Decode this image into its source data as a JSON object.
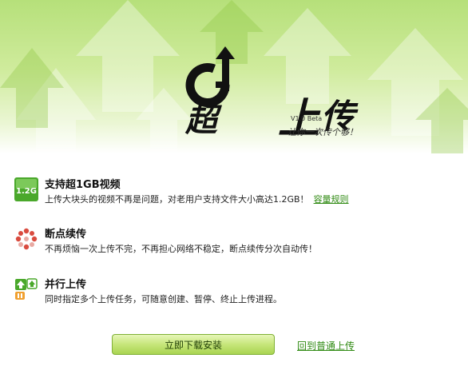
{
  "banner": {
    "logo_chao": "超",
    "logo_shang": "上",
    "logo_chuan": "传",
    "version": "V1.0 Beta",
    "slogan": "让你一次传个够！"
  },
  "features": [
    {
      "icon": "1.2G",
      "title": "支持超1GB视频",
      "desc": "上传大块头的视频不再是问题，对老用户支持文件大小高达1.2GB！",
      "link": "容量规则"
    },
    {
      "icon": "resume-icon",
      "title": "断点续传",
      "desc": "不再烦恼一次上传不完，不再担心网络不稳定，断点续传分次自动传！"
    },
    {
      "icon": "parallel-upload-icon",
      "title": "并行上传",
      "desc": "同时指定多个上传任务，可随意创建、暂停、终止上传进程。"
    }
  ],
  "actions": {
    "install_label": "立即下载安装",
    "back_label": "回到普通上传"
  },
  "colors": {
    "accent": "#2f8a12",
    "banner_green": "#b6e07a"
  }
}
